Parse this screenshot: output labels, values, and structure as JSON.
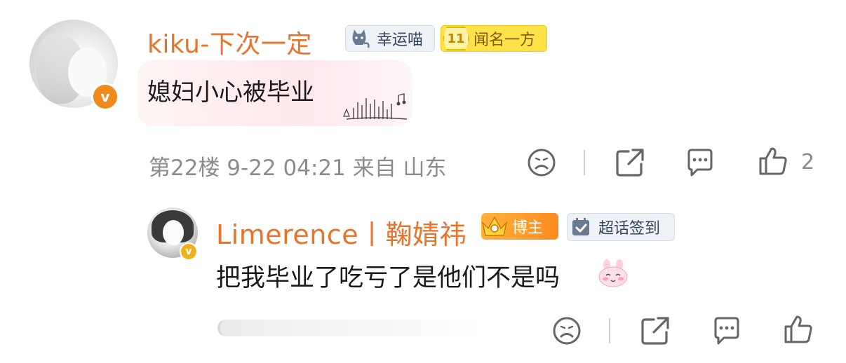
{
  "comment": {
    "username": "kiku-下次一定",
    "badges": [
      {
        "label": "幸运喵",
        "icon": "cat-icon"
      },
      {
        "label": "闻名一方",
        "level": "11",
        "icon": "level-badge-icon"
      }
    ],
    "text": "媳妇小心被毕业",
    "meta": "第22楼 9-22 04:21 来自 山东",
    "likes": "2",
    "colors": {
      "username": "#e8742a",
      "verified": "#f08a1a"
    }
  },
  "reply": {
    "username": "Limerence丨鞠婧祎",
    "badges": [
      {
        "label": "博主",
        "icon": "crown-icon"
      },
      {
        "label": "超话签到",
        "icon": "checkin-icon"
      }
    ],
    "text": "把我毕业了吃亏了是他们不是吗",
    "emoji": "bunny-blush-icon"
  }
}
